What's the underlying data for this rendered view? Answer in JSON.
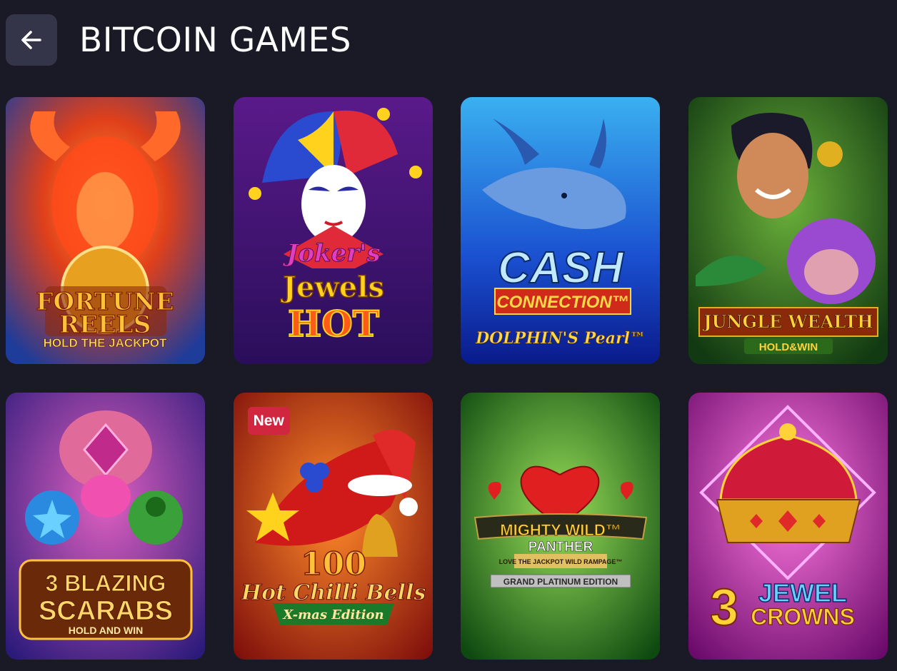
{
  "header": {
    "title": "BITCOIN GAMES",
    "back_icon": "arrow-left-icon"
  },
  "games": [
    {
      "id": "fortune-reels",
      "logo_lines": [
        "FORTUNE",
        "REELS"
      ],
      "tagline": "HOLD THE JACKPOT",
      "colors": {
        "bg1": "#1e3c9a",
        "bg2": "#3b6fd8",
        "accent": "#ff5a1e"
      }
    },
    {
      "id": "jokers-jewels-hot",
      "logo_lines": [
        "Joker's",
        "Jewels",
        "HOT"
      ],
      "colors": {
        "bg1": "#3a1a6e",
        "bg2": "#7a2aa0",
        "accent": "#ffd21e"
      }
    },
    {
      "id": "cash-connection",
      "logo_lines": [
        "CASH",
        "CONNECTION™"
      ],
      "tagline": "DOLPHIN'S Pearl™",
      "colors": {
        "bg1": "#0a2a9a",
        "bg2": "#2a8ae0",
        "accent": "#ffd84a"
      }
    },
    {
      "id": "jungle-wealth",
      "logo_lines": [
        "JUNGLE WEALTH"
      ],
      "tagline": "HOLD&WIN",
      "colors": {
        "bg1": "#1b4a1a",
        "bg2": "#3c8a2a",
        "accent": "#b03a1a"
      }
    },
    {
      "id": "3-blazing-scarabs",
      "logo_lines": [
        "3 BLAZING",
        "SCARABS"
      ],
      "tagline": "HOLD AND WIN",
      "colors": {
        "bg1": "#3a1a8a",
        "bg2": "#a03ab0",
        "accent": "#ffc23a"
      }
    },
    {
      "id": "100-hot-chilli-bells",
      "badge": "New",
      "logo_lines": [
        "100",
        "Hot Chilli Bells"
      ],
      "tagline": "X-mas Edition",
      "colors": {
        "bg1": "#8a0a0a",
        "bg2": "#e0301a",
        "accent": "#ffc03a"
      }
    },
    {
      "id": "mighty-wild-panther",
      "logo_lines": [
        "MIGHTY WILD™",
        "PANTHER"
      ],
      "subtitle": "LOVE THE JACKPOT WILD RAMPAGE™",
      "tagline": "GRAND PLATINUM EDITION",
      "colors": {
        "bg1": "#0e4a10",
        "bg2": "#4ac02a",
        "accent": "#e02020"
      }
    },
    {
      "id": "3-jewel-crowns",
      "logo_lines": [
        "3",
        "JEWEL",
        "CROWNS"
      ],
      "colors": {
        "bg1": "#8a1a8a",
        "bg2": "#e03ac0",
        "accent": "#ffd23a"
      }
    }
  ]
}
